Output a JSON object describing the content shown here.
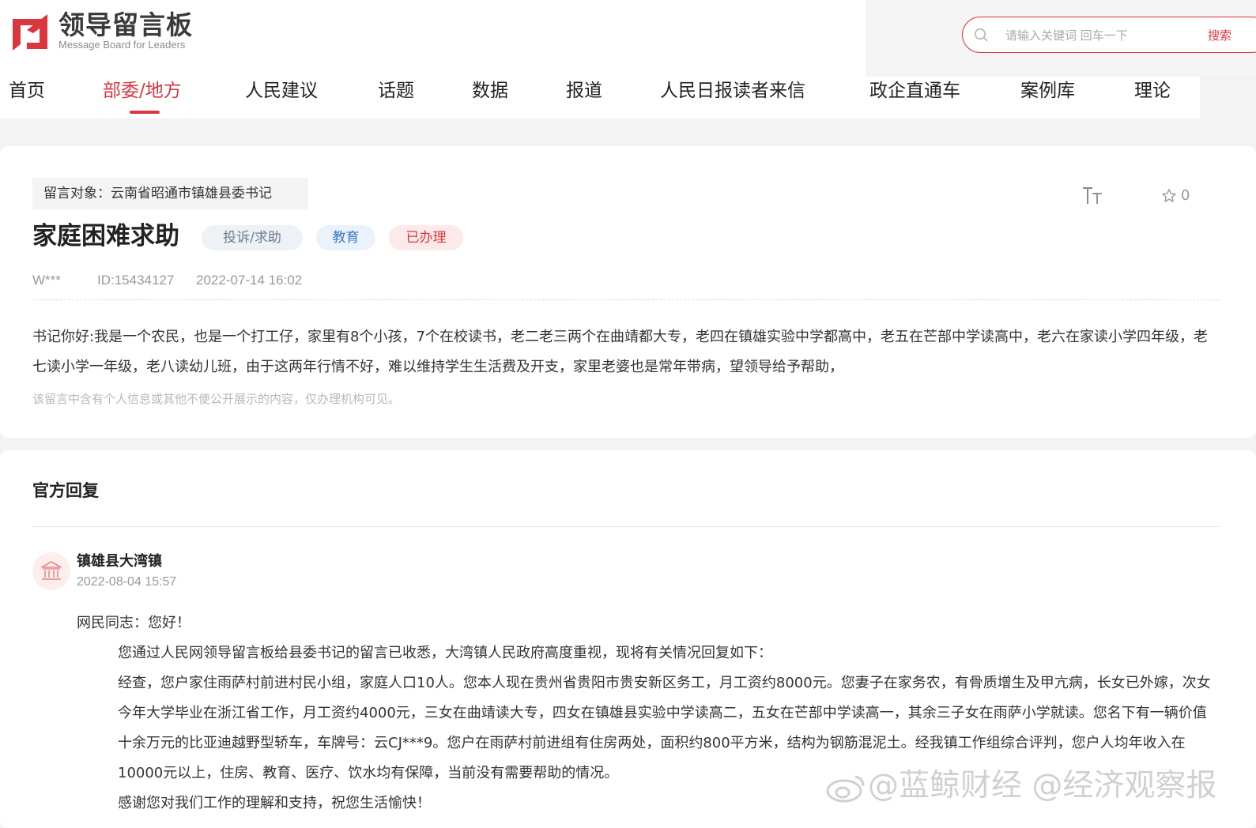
{
  "header": {
    "logo_title": "领导留言板",
    "logo_subtitle": "Message Board for Leaders",
    "search_placeholder": "请输入关键词 回车一下",
    "search_button": "搜索"
  },
  "nav": {
    "items": [
      "首页",
      "部委/地方",
      "人民建议",
      "话题",
      "数据",
      "报道",
      "人民日报读者来信",
      "政企直通车",
      "案例库",
      "理论"
    ],
    "active_index": 1
  },
  "message": {
    "target": "留言对象：云南省昭通市镇雄县委书记",
    "title": "家庭困难求助",
    "category": "投诉/求助",
    "topic": "教育",
    "status": "已办理",
    "favorite_count": "0",
    "user": "W***",
    "id": "ID:15434127",
    "time": "2022-07-14 16:02",
    "body": "书记你好:我是一个农民，也是一个打工仔，家里有8个小孩，7个在校读书，老二老三两个在曲靖都大专，老四在镇雄实验中学都高中，老五在芒部中学读高中，老六在家读小学四年级，老七读小学一年级，老八读幼儿班，由于这两年行情不好，难以维持学生生活费及开支，家里老婆也是常年带病，望领导给予帮助，",
    "privacy_note": "该留言中含有个人信息或其他不便公开展示的内容，仅办理机构可见。"
  },
  "reply": {
    "heading": "官方回复",
    "org_name": "镇雄县大湾镇",
    "org_time": "2022-08-04 15:57",
    "greeting": "网民同志：您好！",
    "para1": "您通过人民网领导留言板给县委书记的留言已收悉，大湾镇人民政府高度重视，现将有关情况回复如下：",
    "para2": "经查，您户家住雨萨村前进村民小组，家庭人口10人。您本人现在贵州省贵阳市贵安新区务工，月工资约8000元。您妻子在家务农，有骨质增生及甲亢病，长女已外嫁，次女今年大学毕业在浙江省工作，月工资约4000元，三女在曲靖读大专，四女在镇雄县实验中学读高二，五女在芒部中学读高一，其余三子女在雨萨小学就读。您名下有一辆价值十余万元的比亚迪越野型轿车，车牌号：云CJ***9。您户在雨萨村前进组有住房两处，面积约800平方米，结构为钢筋混泥土。经我镇工作组综合评判，您户人均年收入在10000元以上，住房、教育、医疗、饮水均有保障，当前没有需要帮助的情况。",
    "para3": "感谢您对我们工作的理解和支持，祝您生活愉快！"
  },
  "watermark": "@蓝鲸财经 @经济观察报",
  "colors": {
    "accent": "#d9363e",
    "text": "#333333",
    "muted": "#999999"
  }
}
